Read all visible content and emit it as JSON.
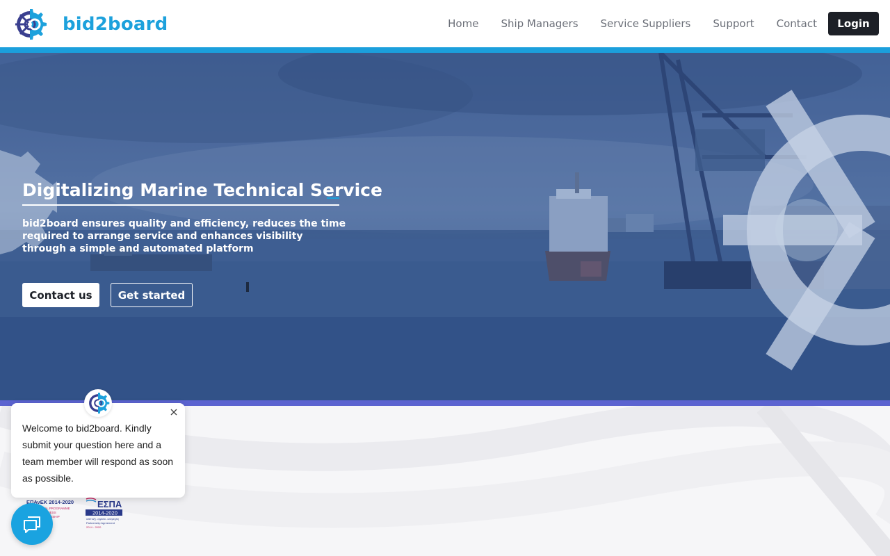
{
  "brand": {
    "name": "bid2board",
    "color": "#1da1dc",
    "logo_dark": "#3a3f8f"
  },
  "nav": {
    "items": [
      "Home",
      "Ship Managers",
      "Service Suppliers",
      "Support",
      "Contact"
    ],
    "login_label": "Login"
  },
  "hero": {
    "title": "Digitalizing Marine Technical Service",
    "description": "bid2board ensures quality and efficiency, reduces the time required to arrange service and enhances visibility through a simple and automated platform",
    "contact_label": "Contact us",
    "start_label": "Get started",
    "accent_color": "#1b9fdc",
    "bottom_bar_color": "#5b63d0"
  },
  "chat": {
    "message": "Welcome to bid2board. Kindly submit your question here and a team member will respond as soon as possible.",
    "launcher_color": "#1aa3e0"
  },
  "funding": {
    "left_logo_text": [
      "ΕΠΑνΕΚ 2014-2020",
      "OPERATIONAL PROGRAMME",
      "COMPETITIVENESS",
      "ENTREPRENEURSHIP",
      "INNOVATION"
    ],
    "right_logo_text": [
      "ΕΣΠΑ",
      "2014-2020",
      "ανάπτυξη - εργασία - αλληλεγγύη",
      "Partnership Agreement",
      "2014 - 2020"
    ]
  }
}
